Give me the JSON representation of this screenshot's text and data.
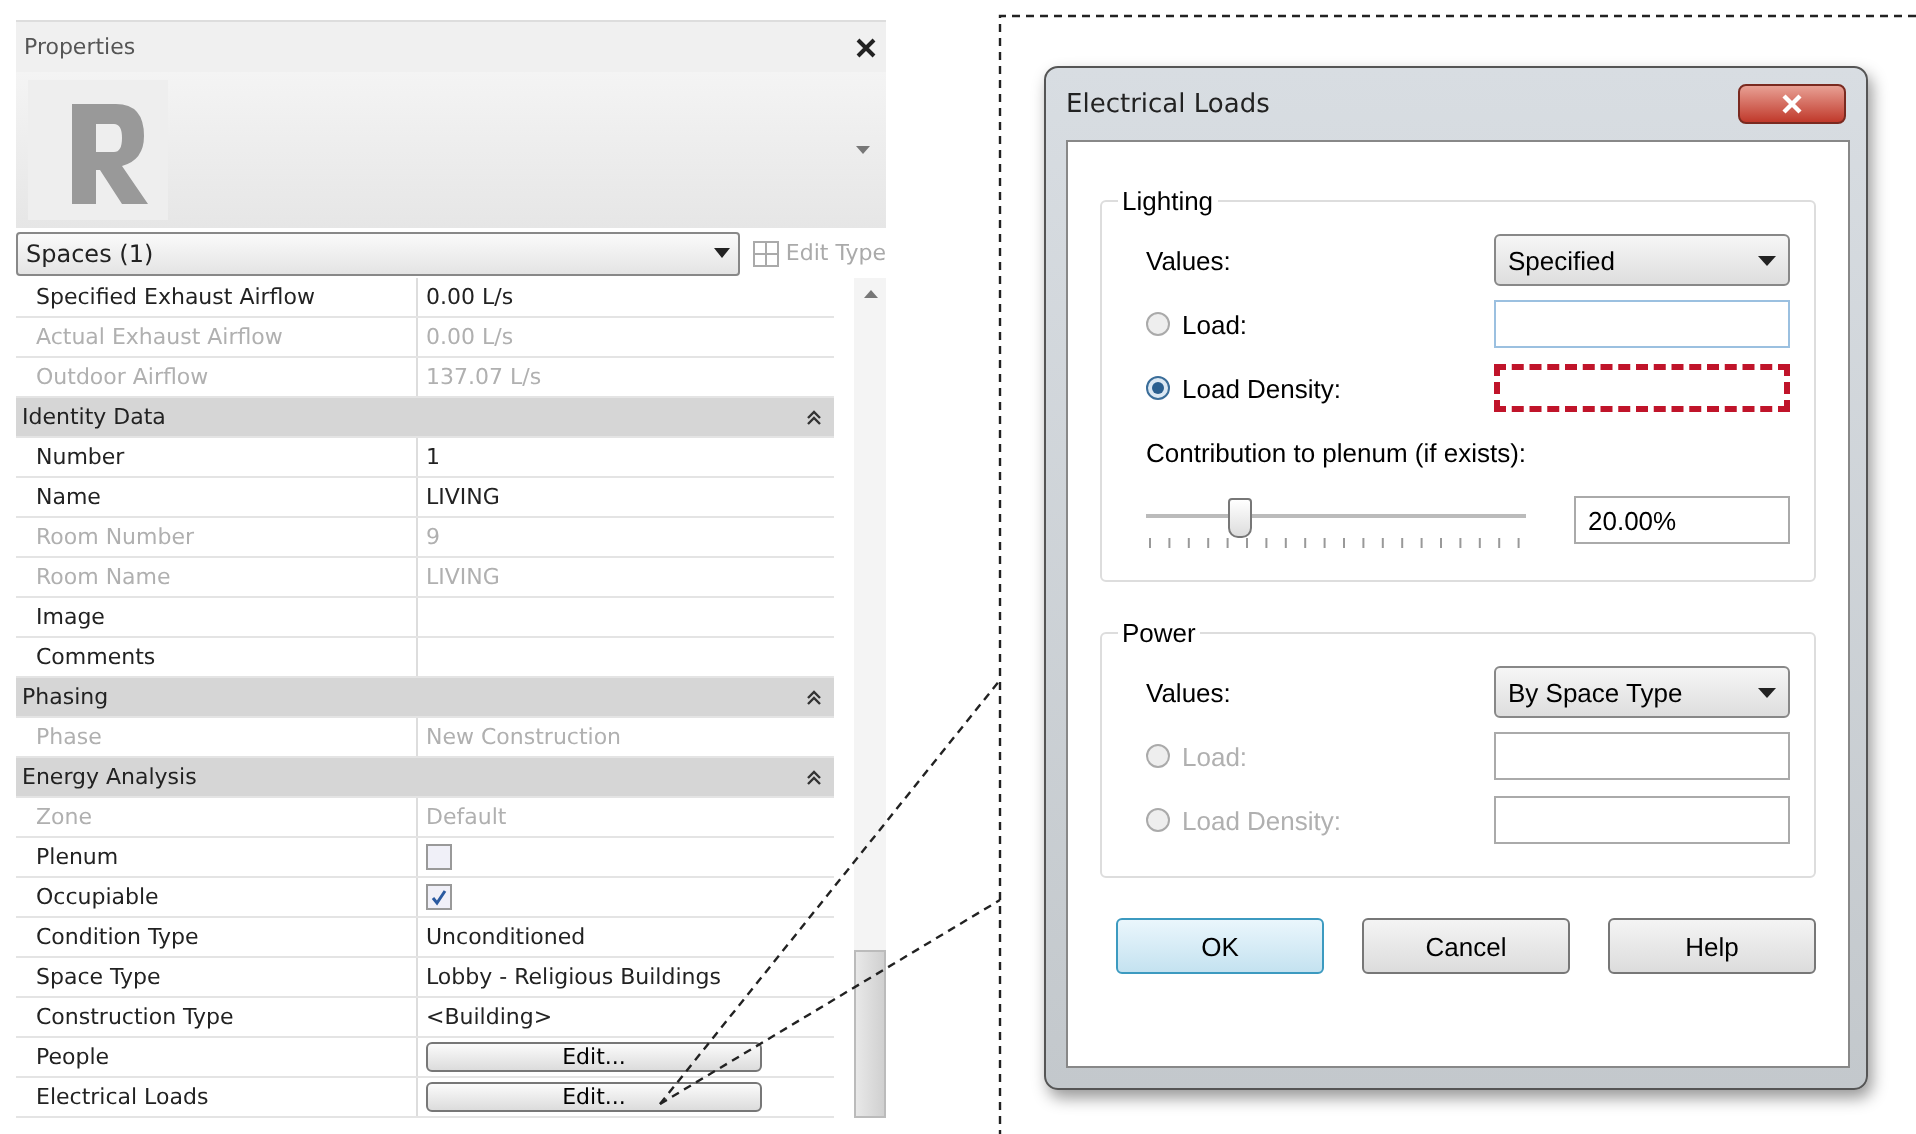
{
  "properties": {
    "title": "Properties",
    "type_selector": "Spaces (1)",
    "edit_type": "Edit Type",
    "rows": [
      {
        "kind": "property",
        "label": "Specified Exhaust Airflow",
        "value": "0.00 L/s",
        "disabled": false
      },
      {
        "kind": "property",
        "label": "Actual Exhaust Airflow",
        "value": "0.00 L/s",
        "disabled": true
      },
      {
        "kind": "property",
        "label": "Outdoor Airflow",
        "value": "137.07 L/s",
        "disabled": true
      },
      {
        "kind": "group",
        "label": "Identity Data"
      },
      {
        "kind": "property",
        "label": "Number",
        "value": "1",
        "disabled": false
      },
      {
        "kind": "property",
        "label": "Name",
        "value": "LIVING",
        "disabled": false
      },
      {
        "kind": "property",
        "label": "Room Number",
        "value": "9",
        "disabled": true
      },
      {
        "kind": "property",
        "label": "Room Name",
        "value": "LIVING",
        "disabled": true
      },
      {
        "kind": "property",
        "label": "Image",
        "disabled": false
      },
      {
        "kind": "property",
        "label": "Comments",
        "disabled": false
      },
      {
        "kind": "group",
        "label": "Phasing"
      },
      {
        "kind": "property",
        "label": "Phase",
        "value": "New Construction",
        "disabled": true
      },
      {
        "kind": "group",
        "label": "Energy Analysis"
      },
      {
        "kind": "property",
        "label": "Zone",
        "value": "Default",
        "disabled": true
      },
      {
        "kind": "checkbox",
        "label": "Plenum",
        "checked": false
      },
      {
        "kind": "checkbox",
        "label": "Occupiable",
        "checked": true
      },
      {
        "kind": "property",
        "label": "Condition Type",
        "value": "Unconditioned",
        "disabled": false
      },
      {
        "kind": "property",
        "label": "Space Type",
        "value": "Lobby - Religious Buildings",
        "disabled": false
      },
      {
        "kind": "property",
        "label": "Construction Type",
        "value": "<Building>",
        "disabled": false
      },
      {
        "kind": "button",
        "label": "People",
        "button": "Edit..."
      },
      {
        "kind": "button",
        "label": "Electrical Loads",
        "button": "Edit..."
      }
    ]
  },
  "dialog": {
    "title": "Electrical Loads",
    "groups": [
      {
        "title": "Lighting",
        "values_label": "Values:",
        "values": "Specified",
        "options": [
          {
            "label": "Load:",
            "selected": false,
            "disabled": false,
            "highlighted": false
          },
          {
            "label": "Load Density:",
            "selected": true,
            "disabled": false,
            "highlighted": true
          }
        ],
        "slider": {
          "label": "Contribution to plenum (if exists):",
          "level": 0.24,
          "reading": "20.00%"
        }
      },
      {
        "title": "Power",
        "values_label": "Values:",
        "values": "By Space Type",
        "options": [
          {
            "label": "Load:",
            "selected": false,
            "disabled": true,
            "highlighted": false
          },
          {
            "label": "Load Density:",
            "selected": false,
            "disabled": true,
            "highlighted": false
          }
        ]
      }
    ],
    "buttons": [
      {
        "label": "OK",
        "default": true
      },
      {
        "label": "Cancel",
        "default": false
      },
      {
        "label": "Help",
        "default": false
      }
    ]
  }
}
